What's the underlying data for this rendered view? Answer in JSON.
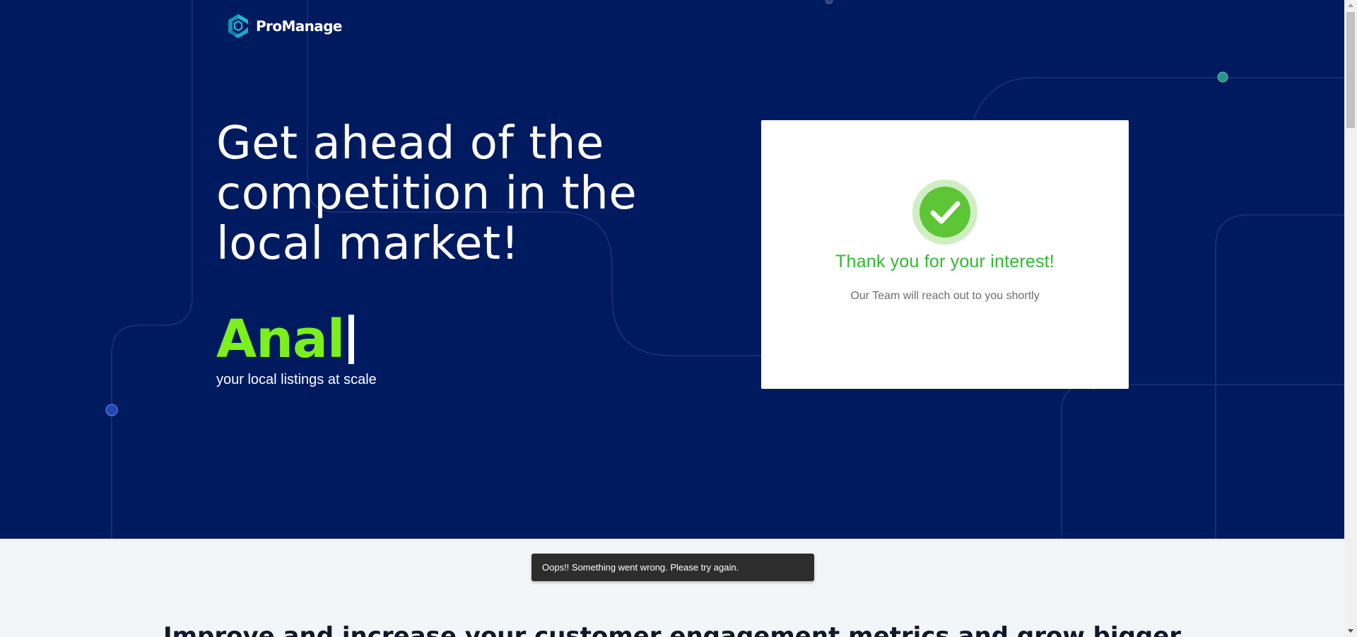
{
  "brand": {
    "name": "ProManage",
    "accent": "#1fb8d6"
  },
  "hero": {
    "headline": "Get ahead of the competition in the local market!",
    "typed_word": "Anal",
    "subline": "your local listings at scale",
    "background": "#001a60",
    "highlight_color": "#7bf01d"
  },
  "confirmation": {
    "icon": "check-circle-icon",
    "title": "Thank you for your interest!",
    "message": "Our Team will reach out to you shortly",
    "success_color": "#2dbb2d"
  },
  "toast": {
    "message": "Oops!! Something went wrong. Please try again."
  },
  "next_section": {
    "heading": "Improve and increase your customer engagement metrics and grow bigger"
  }
}
